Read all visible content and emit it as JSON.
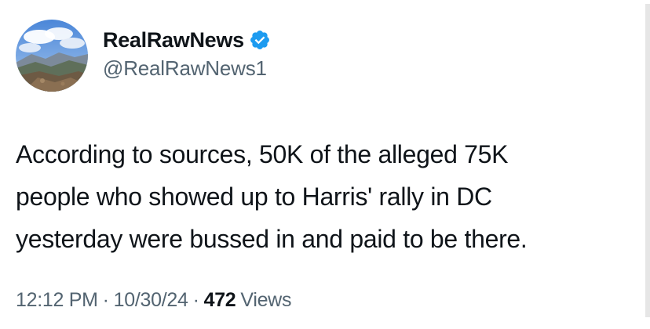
{
  "author": {
    "display_name": "RealRawNews",
    "handle": "@RealRawNews1",
    "verified": true,
    "verified_icon": "verified-badge-icon",
    "verified_color": "#1d9bf0",
    "avatar_icon": "mountain-landscape-avatar"
  },
  "tweet": {
    "text": "According to sources, 50K of the alleged 75K\npeople who showed up to Harris' rally in DC\nyesterday were bussed in and paid to be there."
  },
  "meta": {
    "time": "12:12 PM",
    "separator": "·",
    "date": "10/30/24",
    "views_count": "472",
    "views_label": "Views"
  },
  "colors": {
    "text_primary": "#0f1419",
    "text_secondary": "#536471",
    "background": "#ffffff"
  }
}
